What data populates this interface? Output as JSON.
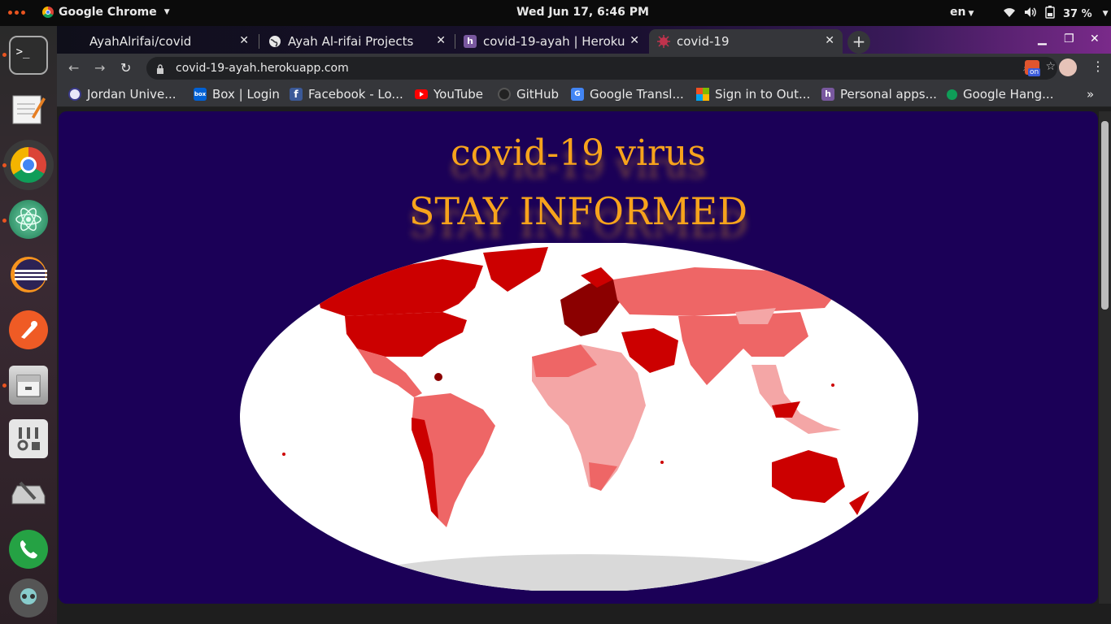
{
  "topbar": {
    "app_name": "Google Chrome",
    "clock": "Wed Jun 17,  6:46 PM",
    "language": "en",
    "battery": "37 %"
  },
  "tabs": [
    {
      "label": "AyahAlrifai/covid",
      "active": false
    },
    {
      "label": "Ayah Al-rifai Projects",
      "active": false
    },
    {
      "label": "covid-19-ayah | Heroku",
      "active": false
    },
    {
      "label": "covid-19",
      "active": true
    }
  ],
  "toolbar": {
    "url": "covid-19-ayah.herokuapp.com",
    "extension_badge": "on"
  },
  "bookmarks": [
    {
      "label": "Jordan Unive...",
      "icon": "university-icon"
    },
    {
      "label": "Box | Login",
      "icon": "box-icon"
    },
    {
      "label": "Facebook - Lo...",
      "icon": "facebook-icon"
    },
    {
      "label": "YouTube",
      "icon": "youtube-icon"
    },
    {
      "label": "GitHub",
      "icon": "github-icon"
    },
    {
      "label": "Google Transl...",
      "icon": "google-translate-icon"
    },
    {
      "label": "Sign in to Out...",
      "icon": "microsoft-icon"
    },
    {
      "label": "Personal apps...",
      "icon": "heroku-icon"
    },
    {
      "label": "Google Hang...",
      "icon": "hangouts-icon"
    }
  ],
  "page": {
    "title_line1": "covid-19 virus",
    "title_line2": "STAY INFORMED"
  },
  "colors": {
    "page_background": "#1b0057",
    "headline": "#f7a31c",
    "map_dark": "#8b0000",
    "map_red": "#cc0000",
    "map_mid": "#ee6666",
    "map_light": "#f4a6a6",
    "map_pale": "#fbd0d0",
    "map_nodata": "#d9d9d9"
  },
  "dock": [
    {
      "name": "terminal-icon",
      "running": true
    },
    {
      "name": "text-editor-icon",
      "running": false
    },
    {
      "name": "chrome-icon",
      "running": true
    },
    {
      "name": "atom-icon",
      "running": true
    },
    {
      "name": "eclipse-icon",
      "running": false
    },
    {
      "name": "postman-icon",
      "running": false
    },
    {
      "name": "file-manager-icon",
      "running": true
    },
    {
      "name": "system-settings-icon",
      "running": false
    },
    {
      "name": "disk-utility-icon",
      "running": false
    },
    {
      "name": "phone-icon",
      "running": false
    },
    {
      "name": "user-avatar-icon",
      "running": false
    }
  ]
}
